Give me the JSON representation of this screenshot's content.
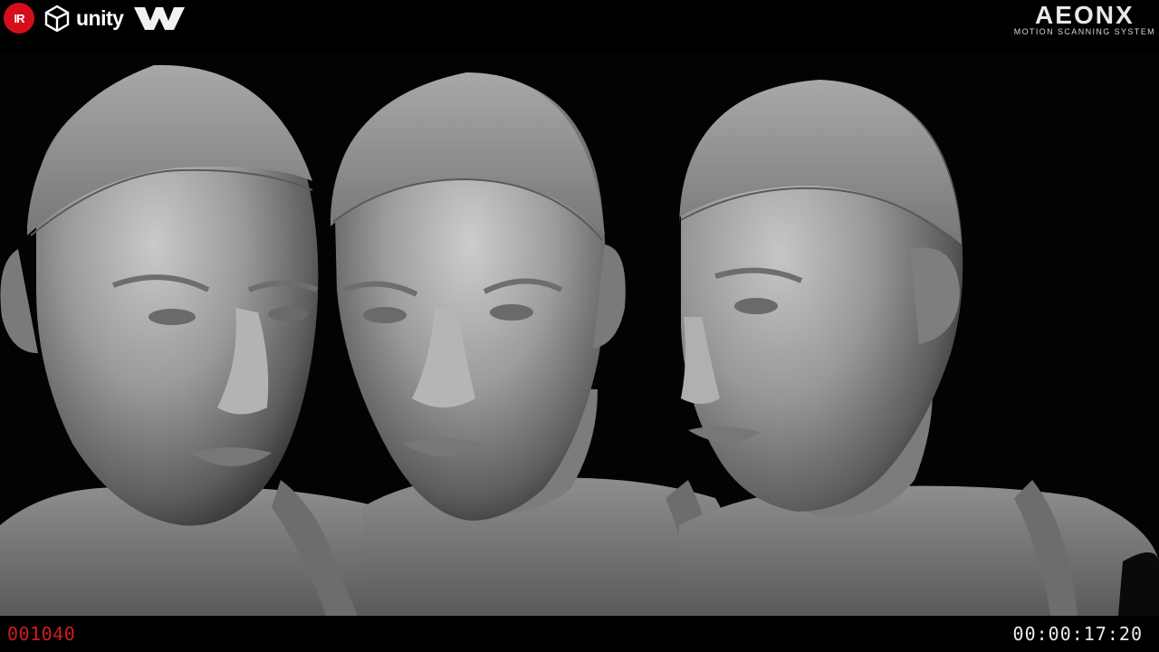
{
  "logos": {
    "ir_text": "IR",
    "unity_text": "unity",
    "aeon_title": "AEONX",
    "aeon_subtitle": "MOTION SCANNING SYSTEM"
  },
  "overlay": {
    "frame_number": "001040",
    "timecode": "00:00:17:20"
  },
  "scene": {
    "subject": "three-quarter-views-of-scanned-male-head",
    "panel_count": 3
  },
  "colors": {
    "background": "#000000",
    "frame_counter": "#d41a20",
    "ir_logo": "#d40f1b",
    "scan_surface": "#8a8a8a"
  }
}
